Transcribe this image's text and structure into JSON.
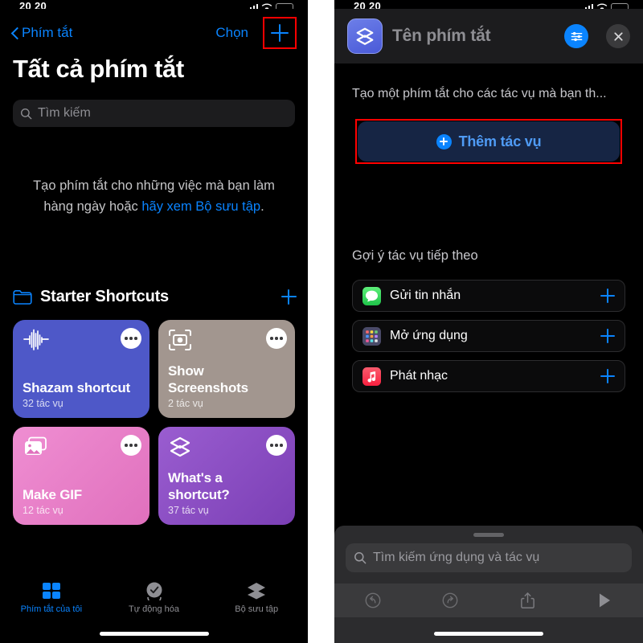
{
  "status_bar": {
    "time": "20 20",
    "signal_icon": "cellular-signal-icon",
    "wifi_icon": "wifi-icon",
    "battery_icon": "battery-icon"
  },
  "left_panel": {
    "nav": {
      "back_icon": "chevron-left-icon",
      "back_label": "Phím tắt",
      "select_label": "Chọn",
      "add_icon": "plus-icon",
      "highlight_color": "#ff0000"
    },
    "page_title": "Tất cả phím tắt",
    "search": {
      "icon": "search-icon",
      "placeholder": "Tìm kiếm"
    },
    "empty_state": {
      "line1": "Tạo phím tắt cho những việc mà bạn làm",
      "line2_prefix": "hàng ngày hoặc ",
      "line2_link": "hãy xem Bộ sưu tập",
      "line2_suffix": ".",
      "link_color": "#0a84ff"
    },
    "section": {
      "folder_icon": "folder-icon",
      "title": "Starter Shortcuts",
      "add_icon": "plus-icon"
    },
    "cards": [
      {
        "name": "Shazam shortcut",
        "subtitle": "32 tác vụ",
        "icon": "waveform-icon",
        "color": "#4e58c8",
        "menu_icon": "more-dots-icon"
      },
      {
        "name": "Show Screenshots",
        "subtitle": "2 tác vụ",
        "icon": "camera-viewfinder-icon",
        "color": "#a2968f",
        "menu_icon": "more-dots-icon"
      },
      {
        "name": "Make GIF",
        "subtitle": "12 tác vụ",
        "icon": "photo-stack-icon",
        "color": "#e77bc6",
        "menu_icon": "more-dots-icon"
      },
      {
        "name": "What's a shortcut?",
        "subtitle": "37 tác vụ",
        "icon": "shortcuts-layers-icon",
        "color": "#8a4ec0",
        "menu_icon": "more-dots-icon"
      }
    ],
    "tabs": [
      {
        "label": "Phím tắt của tôi",
        "icon": "grid-squares-icon",
        "active": true
      },
      {
        "label": "Tự động hóa",
        "icon": "clock-automation-icon",
        "active": false
      },
      {
        "label": "Bộ sưu tập",
        "icon": "layers-gallery-icon",
        "active": false
      }
    ]
  },
  "right_panel": {
    "header": {
      "app_icon": "shortcuts-layers-icon",
      "title": "Tên phím tắt",
      "settings_icon": "sliders-icon",
      "close_icon": "close-icon"
    },
    "description": "Tạo một phím tắt cho các tác vụ mà bạn th...",
    "add_action": {
      "icon": "circle-plus-icon",
      "label": "Thêm tác vụ",
      "highlight_color": "#ff0000"
    },
    "suggestions_title": "Gợi ý tác vụ tiếp theo",
    "suggestions": [
      {
        "label": "Gửi tin nhắn",
        "icon": "messages-app-icon",
        "icon_color": "#34c759",
        "add_icon": "plus-icon"
      },
      {
        "label": "Mở ứng dụng",
        "icon": "app-grid-icon",
        "icon_color": "#5c5c7a",
        "add_icon": "plus-icon"
      },
      {
        "label": "Phát nhạc",
        "icon": "music-app-icon",
        "icon_color": "#fa2d48",
        "add_icon": "plus-icon"
      }
    ],
    "sheet": {
      "grabber": "drag-handle",
      "search": {
        "icon": "search-icon",
        "placeholder": "Tìm kiếm ứng dụng và tác vụ"
      },
      "toolbar": [
        {
          "icon": "undo-icon"
        },
        {
          "icon": "redo-icon"
        },
        {
          "icon": "share-icon"
        },
        {
          "icon": "play-icon"
        }
      ]
    }
  }
}
